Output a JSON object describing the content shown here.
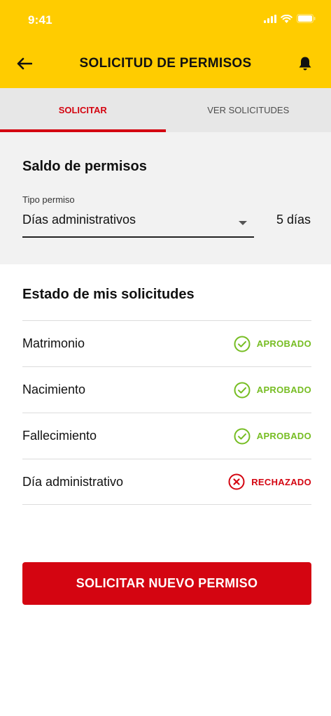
{
  "status_bar": {
    "time": "9:41"
  },
  "header": {
    "title": "SOLICITUD DE PERMISOS",
    "back_icon": "arrow-left-icon",
    "notification_icon": "bell-icon"
  },
  "tabs": [
    {
      "label": "SOLICITAR",
      "active": true
    },
    {
      "label": "VER SOLICITUDES",
      "active": false
    }
  ],
  "saldo": {
    "title": "Saldo de permisos",
    "tipo_label": "Tipo permiso",
    "tipo_value": "Días administrativos",
    "balance": "5 días"
  },
  "estado": {
    "title": "Estado de mis solicitudes",
    "items": [
      {
        "label": "Matrimonio",
        "status": "APROBADO"
      },
      {
        "label": "Nacimiento",
        "status": "APROBADO"
      },
      {
        "label": "Fallecimiento",
        "status": "APROBADO"
      },
      {
        "label": "Día administrativo",
        "status": "RECHAZADO"
      }
    ]
  },
  "cta": {
    "label": "SOLICITAR NUEVO PERMISO"
  },
  "colors": {
    "brand_yellow": "#FFCC00",
    "brand_red": "#D40511",
    "approved_green": "#76BD22"
  }
}
